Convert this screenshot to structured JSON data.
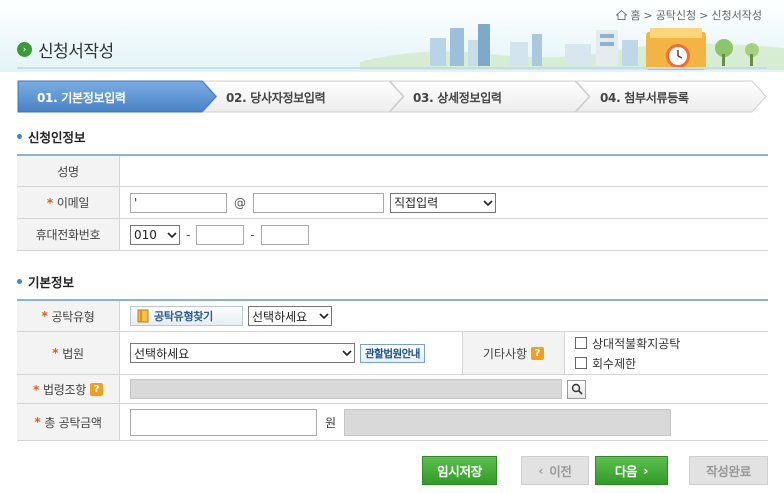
{
  "breadcrumb": [
    "홈",
    "공탁신청",
    "신청서작성"
  ],
  "breadcrumb_sep": ">",
  "page_title": "신청서작성",
  "steps": [
    {
      "label": "01. 기본정보입력",
      "active": true
    },
    {
      "label": "02. 당사자정보입력",
      "active": false
    },
    {
      "label": "03. 상세정보입력",
      "active": false
    },
    {
      "label": "04. 첨부서류등록",
      "active": false
    }
  ],
  "applicant": {
    "section_title": "신청인정보",
    "name_label": "성명",
    "email_label": "이메일",
    "email_local_value": "'",
    "email_at": "@",
    "email_domain_value": "",
    "email_select_value": "직접입력",
    "phone_label": "휴대전화번호",
    "phone_prefix_value": "010",
    "phone_dash": "-"
  },
  "basic": {
    "section_title": "기본정보",
    "deposit_type_label": "공탁유형",
    "deposit_type_button": "공탁유형찾기",
    "deposit_type_select": "선택하세요",
    "court_label": "법원",
    "court_select": "선택하세요",
    "court_button": "관할법원안내",
    "other_label": "기타사항",
    "other_options": [
      "상대적불확지공탁",
      "회수제한"
    ],
    "law_label": "법령조항",
    "amount_label": "총 공탁금액",
    "amount_unit": "원"
  },
  "buttons": {
    "temp_save": "임시저장",
    "prev": "이전",
    "next": "다음",
    "complete": "작성완료"
  },
  "colors": {
    "active_step": "#5b91d0",
    "required_mark": "#e05a1c",
    "green_button": "#3aa52f"
  }
}
